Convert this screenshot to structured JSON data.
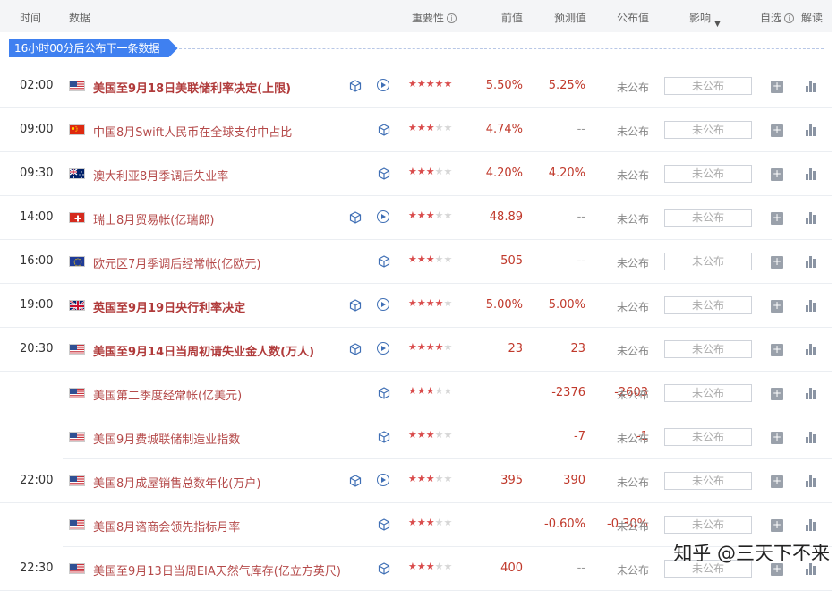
{
  "header": {
    "col_time": "时间",
    "col_data": "数据",
    "col_importance": "重要性",
    "col_prev": "前值",
    "col_forecast": "预测值",
    "col_actual": "公布值",
    "col_impact": "影响",
    "col_watch": "自选",
    "col_explain": "解读"
  },
  "banner": {
    "text": "16小时00分后公布下一条数据"
  },
  "rows": [
    {
      "time": "02:00",
      "flag": "us",
      "name": "美国至9月18日美联储利率决定(上限)",
      "bold": true,
      "has_video": true,
      "stars": 5,
      "prev": "5.50%",
      "forecast": "5.25%",
      "actual": "未公布",
      "impact": "未公布"
    },
    {
      "time": "09:00",
      "flag": "cn",
      "name": "中国8月Swift人民币在全球支付中占比",
      "bold": false,
      "has_video": false,
      "stars": 3,
      "prev": "4.74%",
      "forecast": "--",
      "actual": "未公布",
      "impact": "未公布"
    },
    {
      "time": "09:30",
      "flag": "au",
      "name": "澳大利亚8月季调后失业率",
      "bold": false,
      "has_video": false,
      "stars": 3,
      "prev": "4.20%",
      "forecast": "4.20%",
      "actual": "未公布",
      "impact": "未公布"
    },
    {
      "time": "14:00",
      "flag": "ch",
      "name": "瑞士8月贸易帐(亿瑞郎)",
      "bold": false,
      "has_video": true,
      "stars": 3,
      "prev": "48.89",
      "forecast": "--",
      "actual": "未公布",
      "impact": "未公布"
    },
    {
      "time": "16:00",
      "flag": "eu",
      "name": "欧元区7月季调后经常帐(亿欧元)",
      "bold": false,
      "has_video": false,
      "stars": 3,
      "prev": "505",
      "forecast": "--",
      "actual": "未公布",
      "impact": "未公布"
    },
    {
      "time": "19:00",
      "flag": "uk",
      "name": "英国至9月19日央行利率决定",
      "bold": true,
      "has_video": true,
      "stars": 4,
      "prev": "5.00%",
      "forecast": "5.00%",
      "actual": "未公布",
      "impact": "未公布"
    },
    {
      "time": "20:30",
      "flag": "us",
      "name": "美国至9月14日当周初请失业金人数(万人)",
      "bold": true,
      "has_video": true,
      "stars": 4,
      "prev": "23",
      "forecast": "23",
      "actual": "未公布",
      "impact": "未公布"
    },
    {
      "time": "",
      "flag": "us",
      "name": "美国第二季度经常帐(亿美元)",
      "bold": false,
      "has_video": false,
      "stars": 3,
      "prev": "-2376",
      "forecast": "-2603",
      "actual": "未公布",
      "impact": "未公布",
      "sub": true
    },
    {
      "time": "",
      "flag": "us",
      "name": "美国9月费城联储制造业指数",
      "bold": false,
      "has_video": false,
      "stars": 3,
      "prev": "-7",
      "forecast": "-1",
      "actual": "未公布",
      "impact": "未公布",
      "sub": true
    },
    {
      "time": "22:00",
      "flag": "us",
      "name": "美国8月成屋销售总数年化(万户)",
      "bold": false,
      "has_video": true,
      "stars": 3,
      "prev": "395",
      "forecast": "390",
      "actual": "未公布",
      "impact": "未公布"
    },
    {
      "time": "",
      "flag": "us",
      "name": "美国8月谘商会领先指标月率",
      "bold": false,
      "has_video": false,
      "stars": 3,
      "prev": "-0.60%",
      "forecast": "-0.30%",
      "actual": "未公布",
      "impact": "未公布",
      "sub": true
    },
    {
      "time": "22:30",
      "flag": "us",
      "name": "美国至9月13日当周EIA天然气库存(亿立方英尺)",
      "bold": false,
      "has_video": false,
      "stars": 3,
      "prev": "400",
      "forecast": "--",
      "actual": "未公布",
      "impact": "未公布"
    }
  ],
  "credit": "知乎 @三天下不来",
  "colors": {
    "accent": "#3f80f0",
    "value_red": "#c0392b",
    "star_red": "#d94b4b"
  }
}
